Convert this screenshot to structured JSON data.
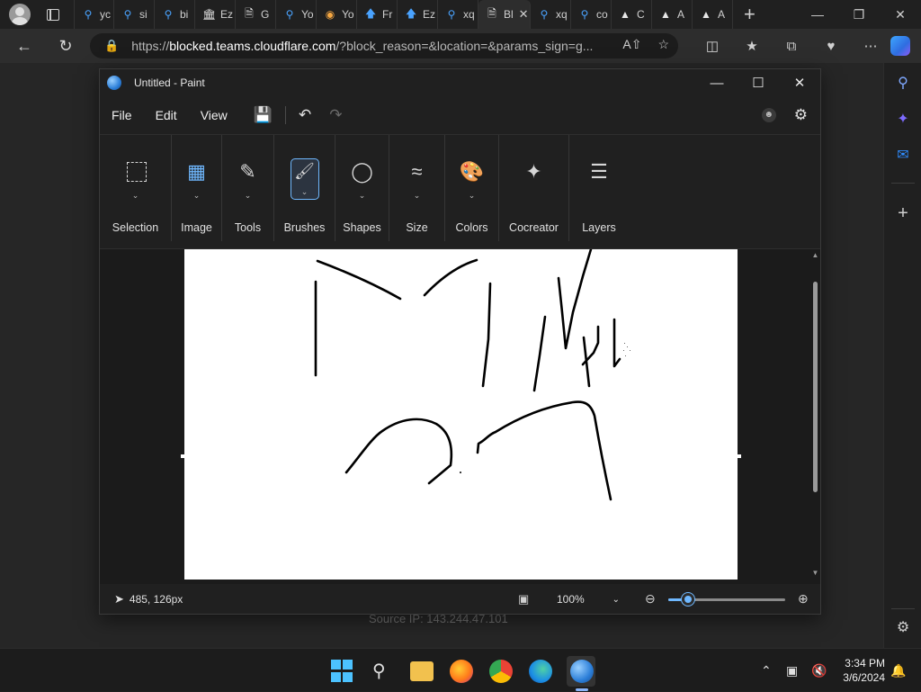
{
  "browser": {
    "tabs": [
      {
        "icon": "search-icon",
        "label": "yc"
      },
      {
        "icon": "search-icon",
        "label": "si"
      },
      {
        "icon": "search-icon",
        "label": "bi"
      },
      {
        "icon": "bank-icon",
        "label": "Ez"
      },
      {
        "icon": "page-icon",
        "label": "G"
      },
      {
        "icon": "search-icon",
        "label": "Yo"
      },
      {
        "icon": "coin-icon",
        "label": "Yo"
      },
      {
        "icon": "arrow-up-icon",
        "label": "Fr"
      },
      {
        "icon": "arrow-up-icon",
        "label": "Ez"
      },
      {
        "icon": "search-icon",
        "label": "xq"
      },
      {
        "icon": "page-icon",
        "label": "Bl",
        "active": true
      },
      {
        "icon": "search-icon",
        "label": "xq"
      },
      {
        "icon": "search-icon",
        "label": "co"
      },
      {
        "icon": "hat-icon",
        "label": "C"
      },
      {
        "icon": "hat-icon",
        "label": "A"
      },
      {
        "icon": "hat-icon",
        "label": "A"
      }
    ],
    "url_scheme": "https://",
    "url_host": "blocked.teams.cloudflare.com",
    "url_rest": "/?block_reason=&location=&params_sign=g..."
  },
  "page": {
    "source_ip": "Source IP: 143.244.47.101"
  },
  "paint": {
    "title": "Untitled - Paint",
    "menu": {
      "file": "File",
      "edit": "Edit",
      "view": "View"
    },
    "ribbon": [
      {
        "key": "selection",
        "label": "Selection"
      },
      {
        "key": "image",
        "label": "Image"
      },
      {
        "key": "tools",
        "label": "Tools"
      },
      {
        "key": "brushes",
        "label": "Brushes"
      },
      {
        "key": "shapes",
        "label": "Shapes"
      },
      {
        "key": "size",
        "label": "Size"
      },
      {
        "key": "colors",
        "label": "Colors"
      },
      {
        "key": "cocreator",
        "label": "Cocreator"
      },
      {
        "key": "layers",
        "label": "Layers"
      }
    ],
    "status": {
      "coords": "485, 126px",
      "zoom": "100%",
      "zoom_fraction": 0.17
    },
    "accent_color": "#6fb8ff"
  },
  "taskbar": {
    "time": "3:34 PM",
    "date": "3/6/2024"
  }
}
